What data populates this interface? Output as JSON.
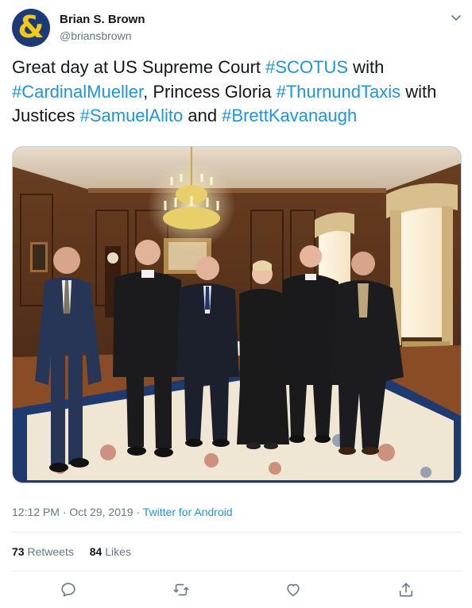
{
  "author": {
    "display_name": "Brian S. Brown",
    "handle": "@briansbrown",
    "avatar_glyph": "&",
    "avatar_bg": "#1d3a78",
    "avatar_fg": "#f2c919"
  },
  "tweet": {
    "segments": [
      {
        "text": "Great day at US Supreme Court ",
        "hashtag": false
      },
      {
        "text": "#SCOTUS",
        "hashtag": true
      },
      {
        "text": " with ",
        "hashtag": false
      },
      {
        "text": "#CardinalMueller",
        "hashtag": true
      },
      {
        "text": ", Princess Gloria ",
        "hashtag": false
      },
      {
        "text": "#ThurnundTaxis",
        "hashtag": true
      },
      {
        "text": " with Justices ",
        "hashtag": false
      },
      {
        "text": "#SamuelAlito",
        "hashtag": true
      },
      {
        "text": " and ",
        "hashtag": false
      },
      {
        "text": "#BrettKavanaugh",
        "hashtag": true
      }
    ]
  },
  "meta": {
    "time": "12:12 PM",
    "separator": " · ",
    "date": "Oct 29, 2019",
    "source": "Twitter for Android"
  },
  "stats": {
    "retweets_count": "73",
    "retweets_label": "Retweets",
    "likes_count": "84",
    "likes_label": "Likes"
  },
  "icons": {
    "menu": "chevron-down-icon",
    "reply": "reply-icon",
    "retweet": "retweet-icon",
    "like": "heart-icon",
    "share": "share-icon"
  },
  "colors": {
    "link": "#1b95e0",
    "secondary_text": "#657786",
    "primary_text": "#14171a"
  }
}
